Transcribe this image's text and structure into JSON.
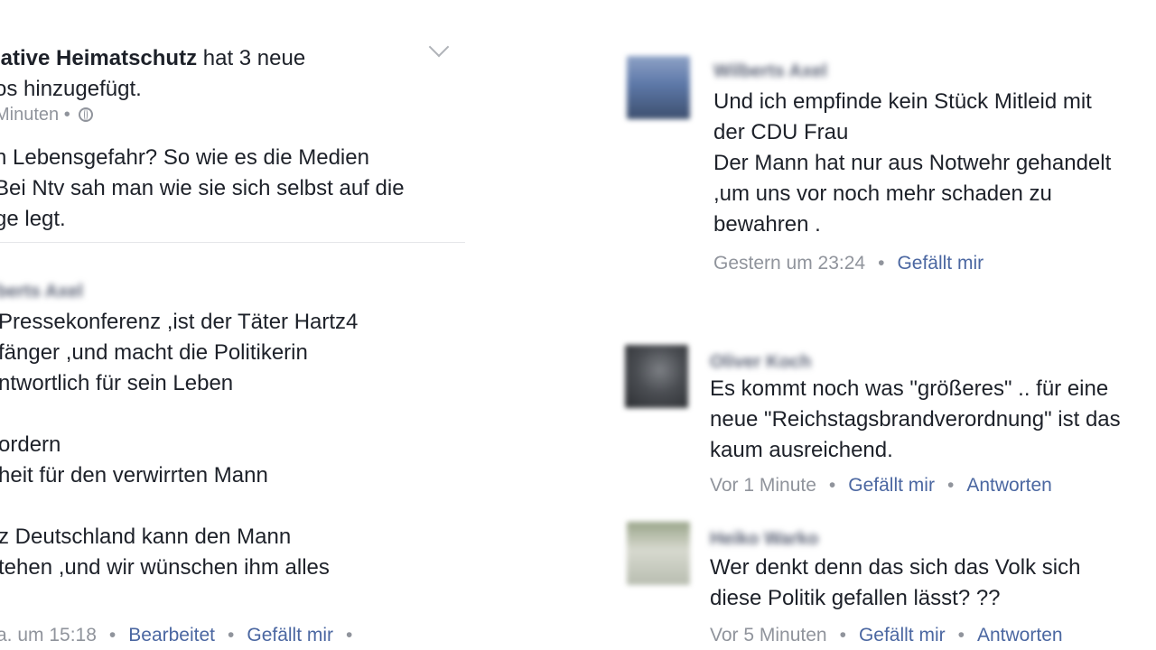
{
  "left_post": {
    "author": "iative Heimatschutz",
    "header_suffix": " hat 3 neue",
    "header_line2": "os hinzugefügt.",
    "meta_time": "Minuten •",
    "body_lines": [
      "n Lebensgefahr? So wie es die Medien",
      "Bei Ntv sah man wie sie sich selbst auf die",
      "ge legt."
    ]
  },
  "left_comment": {
    "author": "berts Axel",
    "lines": [
      "Pressekonferenz ,ist der Täter Hartz4",
      "fänger ,und macht die Politikerin",
      "ntwortlich für sein Leben",
      "",
      "ordern",
      "heit für den verwirrten Mann",
      "",
      "z Deutschland kann den Mann",
      "tehen ,und wir wünschen ihm alles"
    ],
    "time": "a. um 15:18",
    "edited": "Bearbeitet",
    "like": "Gefällt mir",
    "trailing_dot": "•"
  },
  "right_comments": [
    {
      "author": "Wilberts Axel",
      "lines": [
        "Und ich empfinde kein Stück Mitleid mit",
        "der CDU Frau",
        "Der Mann hat nur aus Notwehr gehandelt",
        ",um uns vor noch mehr schaden zu",
        "bewahren ."
      ],
      "time": "Gestern um 23:24",
      "like": "Gefällt mir",
      "reply": ""
    },
    {
      "author": "Oliver Koch",
      "lines": [
        "Es kommt noch was \"größeres\" .. für eine",
        "neue \"Reichstagsbrandverordnung\" ist das",
        "kaum ausreichend."
      ],
      "time": "Vor 1 Minute",
      "like": "Gefällt mir",
      "reply": "Antworten"
    },
    {
      "author": "Heiko Warko",
      "lines": [
        "Wer denkt denn das sich das Volk sich",
        "diese Politik gefallen lässt? ??"
      ],
      "time": "Vor 5 Minuten",
      "like": "Gefällt mir",
      "reply": "Antworten"
    }
  ],
  "separator": "•",
  "colors": {
    "link": "#4b67a1",
    "meta": "#90949c",
    "text": "#1d2129"
  }
}
